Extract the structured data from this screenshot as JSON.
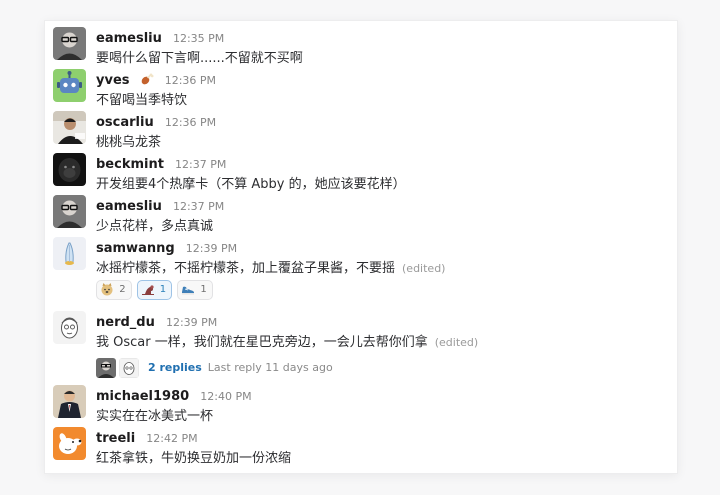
{
  "messages": [
    {
      "user": "eamesliu",
      "time": "12:35 PM",
      "text": "要喝什么留下言啊......不留就不买啊"
    },
    {
      "user": "yves",
      "time": "12:36 PM",
      "text": "不留喝当季特饮",
      "status_emoji": "drumstick-icon"
    },
    {
      "user": "oscarliu",
      "time": "12:36 PM",
      "text": "桃桃乌龙茶"
    },
    {
      "user": "beckmint",
      "time": "12:37 PM",
      "text": "开发组要4个热摩卡（不算 Abby 的，她应该要花样）"
    },
    {
      "user": "eamesliu",
      "time": "12:37 PM",
      "text": "少点花样，多点真诚"
    },
    {
      "user": "samwanng",
      "time": "12:39 PM",
      "text": "冰摇柠檬茶，不摇柠檬茶，加上覆盆子果酱，不要摇",
      "edited": "(edited)",
      "reactions": [
        {
          "icon": "doge-icon",
          "count": "2"
        },
        {
          "icon": "biceps-icon",
          "count": "1"
        },
        {
          "icon": "sneaker-icon",
          "count": "1"
        }
      ]
    },
    {
      "user": "nerd_du",
      "time": "12:39 PM",
      "text": "我 Oscar 一样，我们就在星巴克旁边，一会儿去帮你们拿",
      "edited": "(edited)",
      "thread": {
        "replies": "2 replies",
        "last_reply": "Last reply 11 days ago"
      }
    },
    {
      "user": "michael1980",
      "time": "12:40 PM",
      "text": "实实在在冰美式一杯"
    },
    {
      "user": "treeli",
      "time": "12:42 PM",
      "text": "红茶拿铁，牛奶换豆奶加一份浓缩"
    }
  ],
  "colors": {
    "username": "#1d1c1d",
    "timestamp": "#868686",
    "link": "#1f6fb0",
    "reaction_active_border": "#9ec3e6"
  }
}
